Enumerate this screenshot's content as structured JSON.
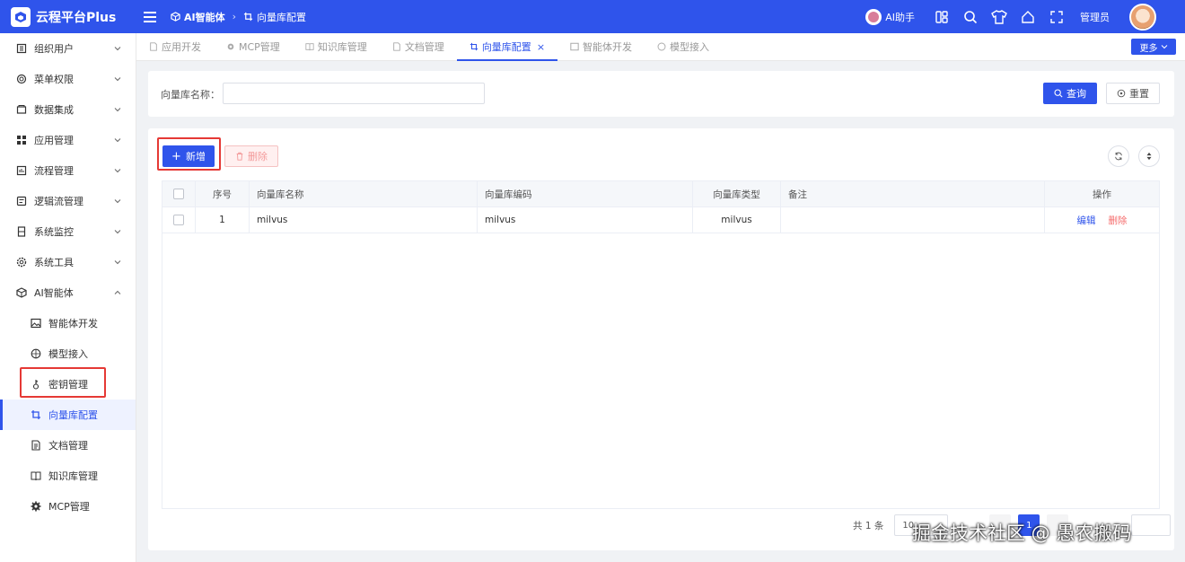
{
  "header": {
    "logo_text": "云程平台Plus",
    "breadcrumb": [
      {
        "label": "AI智能体",
        "icon": "cube-icon"
      },
      {
        "label": "向量库配置",
        "icon": "crop-icon"
      }
    ],
    "ai_helper": "AI助手",
    "admin": "管理员",
    "colors": {
      "primary": "#2f54eb"
    }
  },
  "sidebar": {
    "items": [
      {
        "label": "组织用户",
        "icon": "org-icon"
      },
      {
        "label": "菜单权限",
        "icon": "menu-permission-icon"
      },
      {
        "label": "数据集成",
        "icon": "data-icon"
      },
      {
        "label": "应用管理",
        "icon": "grid-icon"
      },
      {
        "label": "流程管理",
        "icon": "flow-icon"
      },
      {
        "label": "逻辑流管理",
        "icon": "logic-icon"
      },
      {
        "label": "系统监控",
        "icon": "monitor-icon"
      },
      {
        "label": "系统工具",
        "icon": "gear-icon"
      },
      {
        "label": "AI智能体",
        "icon": "cube-icon"
      }
    ],
    "sub_items": [
      {
        "label": "智能体开发",
        "icon": "image-icon"
      },
      {
        "label": "模型接入",
        "icon": "model-icon"
      },
      {
        "label": "密钥管理",
        "icon": "key-icon"
      },
      {
        "label": "向量库配置",
        "icon": "crop-icon"
      },
      {
        "label": "文档管理",
        "icon": "document-icon"
      },
      {
        "label": "知识库管理",
        "icon": "book-icon"
      },
      {
        "label": "MCP管理",
        "icon": "gear-icon"
      }
    ]
  },
  "tabs": {
    "items": [
      {
        "label": "应用开发"
      },
      {
        "label": "MCP管理"
      },
      {
        "label": "知识库管理"
      },
      {
        "label": "文档管理"
      },
      {
        "label": "向量库配置",
        "close": "×"
      },
      {
        "label": "智能体开发"
      },
      {
        "label": "模型接入"
      }
    ],
    "more": "更多"
  },
  "search": {
    "label": "向量库名称：",
    "placeholder": "",
    "query": "查询",
    "reset": "重置"
  },
  "toolbar": {
    "add": "新增",
    "delete": "删除"
  },
  "table": {
    "headers": {
      "index": "序号",
      "name": "向量库名称",
      "code": "向量库编码",
      "type": "向量库类型",
      "note": "备注",
      "op": "操作"
    },
    "rows": [
      {
        "index": "1",
        "name": "milvus",
        "code": "milvus",
        "type": "milvus",
        "note": "",
        "edit": "编辑",
        "delete": "删除"
      }
    ]
  },
  "pager": {
    "total": "共 1 条",
    "size": "10",
    "page": "1"
  },
  "watermark": "掘金技术社区 @ 愚农搬码"
}
